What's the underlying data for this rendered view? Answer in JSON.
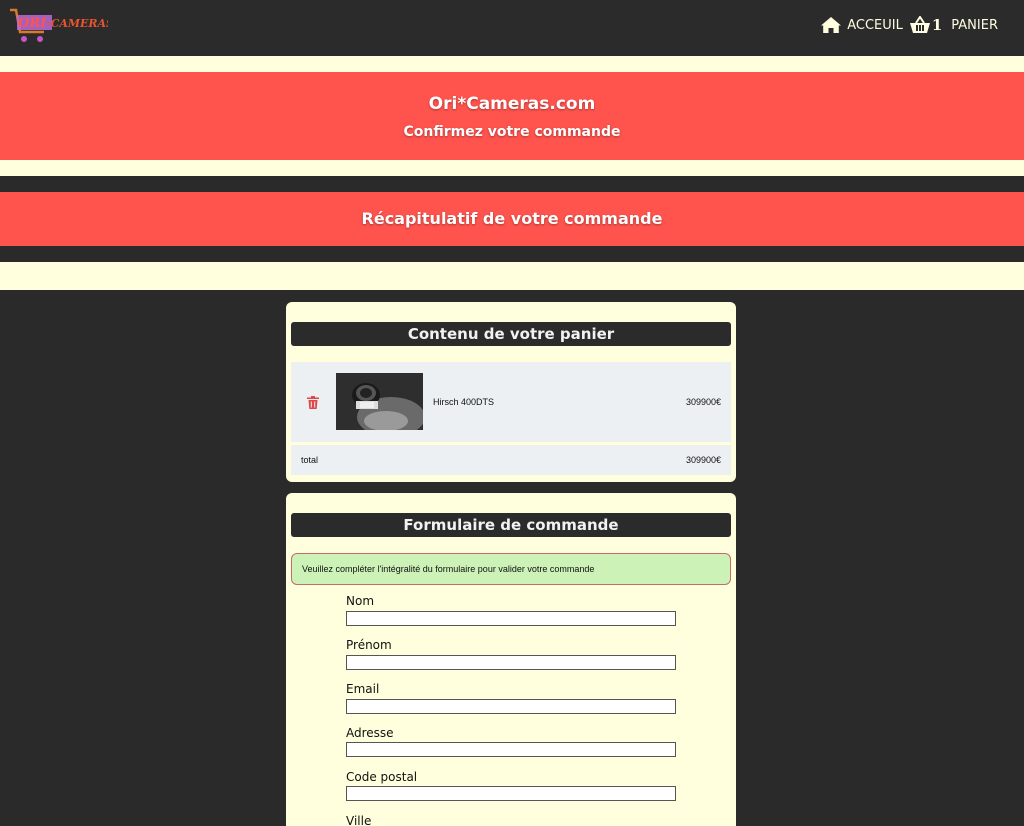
{
  "header": {
    "logo_text": "ORI-CAMERAS",
    "logo_tagline": "Ori Cameras",
    "nav": {
      "home_label": "ACCEUIL",
      "cart_count": "1",
      "cart_label": "PANIER"
    }
  },
  "hero": {
    "site_name": "Ori*Cameras.com",
    "subtitle": "Confirmez votre commande"
  },
  "recap": {
    "title": "Récapitulatif de votre commande"
  },
  "cart": {
    "title": "Contenu de votre panier",
    "items": [
      {
        "name": "Hirsch 400DTS",
        "price": "309900€",
        "icon": "trash-icon"
      }
    ],
    "total_label": "total",
    "total_price": "309900€"
  },
  "form": {
    "title": "Formulaire de commande",
    "notice": "Veuillez compléter l'intégralité du formulaire pour valider votre commande",
    "fields": [
      {
        "label": "Nom",
        "value": ""
      },
      {
        "label": "Prénom",
        "value": ""
      },
      {
        "label": "Email",
        "value": ""
      },
      {
        "label": "Adresse",
        "value": ""
      },
      {
        "label": "Code postal",
        "value": ""
      },
      {
        "label": "Ville",
        "value": ""
      }
    ]
  },
  "colors": {
    "accent_red": "#ff534d",
    "cream": "#fffedd",
    "dark": "#2b2b2b",
    "notice_green": "#ccf2b8"
  }
}
